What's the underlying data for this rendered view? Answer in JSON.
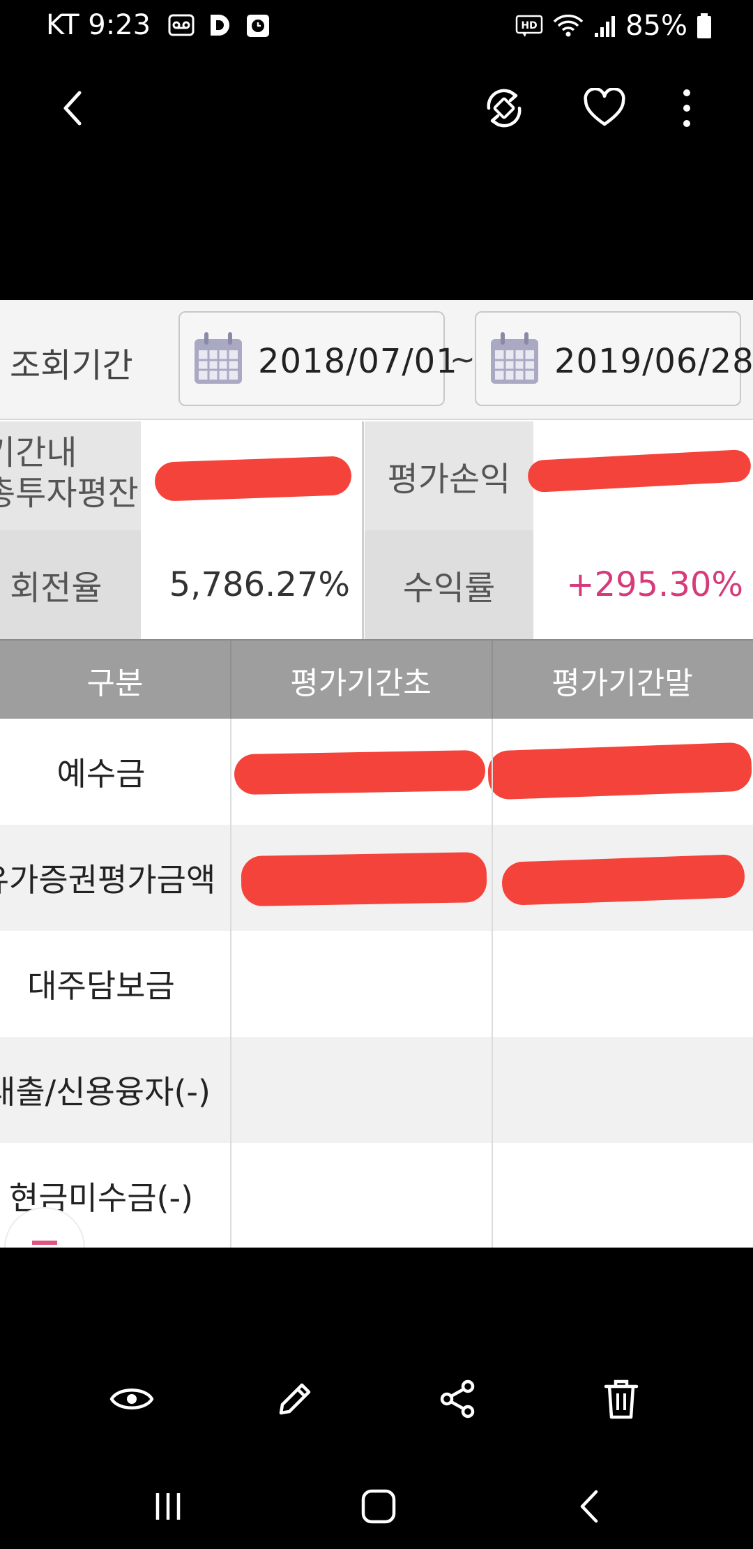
{
  "status_bar": {
    "carrier": "KT",
    "time": "9:23",
    "hd_label": "HD",
    "battery": "85%"
  },
  "viewer": {
    "icons": [
      "back-icon",
      "rotate-icon",
      "heart-icon",
      "more-icon",
      "eye-icon",
      "pencil-icon",
      "share-icon",
      "trash-icon"
    ]
  },
  "capture": {
    "period": {
      "label": "조회기간",
      "from": "2018/07/01",
      "separator": "~",
      "to": "2019/06/28"
    },
    "summary": {
      "row1_label_left": "기간내\n총투자평잔",
      "row1_label_right": "평가손익",
      "row2_label_left": "회전율",
      "row2_value_left": "5,786.27%",
      "row2_label_right": "수익률",
      "row2_value_right": "+295.30%"
    },
    "table": {
      "headers": [
        "구분",
        "평가기간초",
        "평가기간말"
      ],
      "rows": [
        {
          "label": "예수금"
        },
        {
          "label": "유가증권평가금액"
        },
        {
          "label": "대주담보금"
        },
        {
          "label": "대출/신용융자(-)"
        },
        {
          "label": "현금미수금(-)"
        }
      ]
    }
  },
  "colors": {
    "accent_positive": "#d63a7a",
    "header_bg": "#9e9e9e",
    "redaction": "#f4433a"
  }
}
